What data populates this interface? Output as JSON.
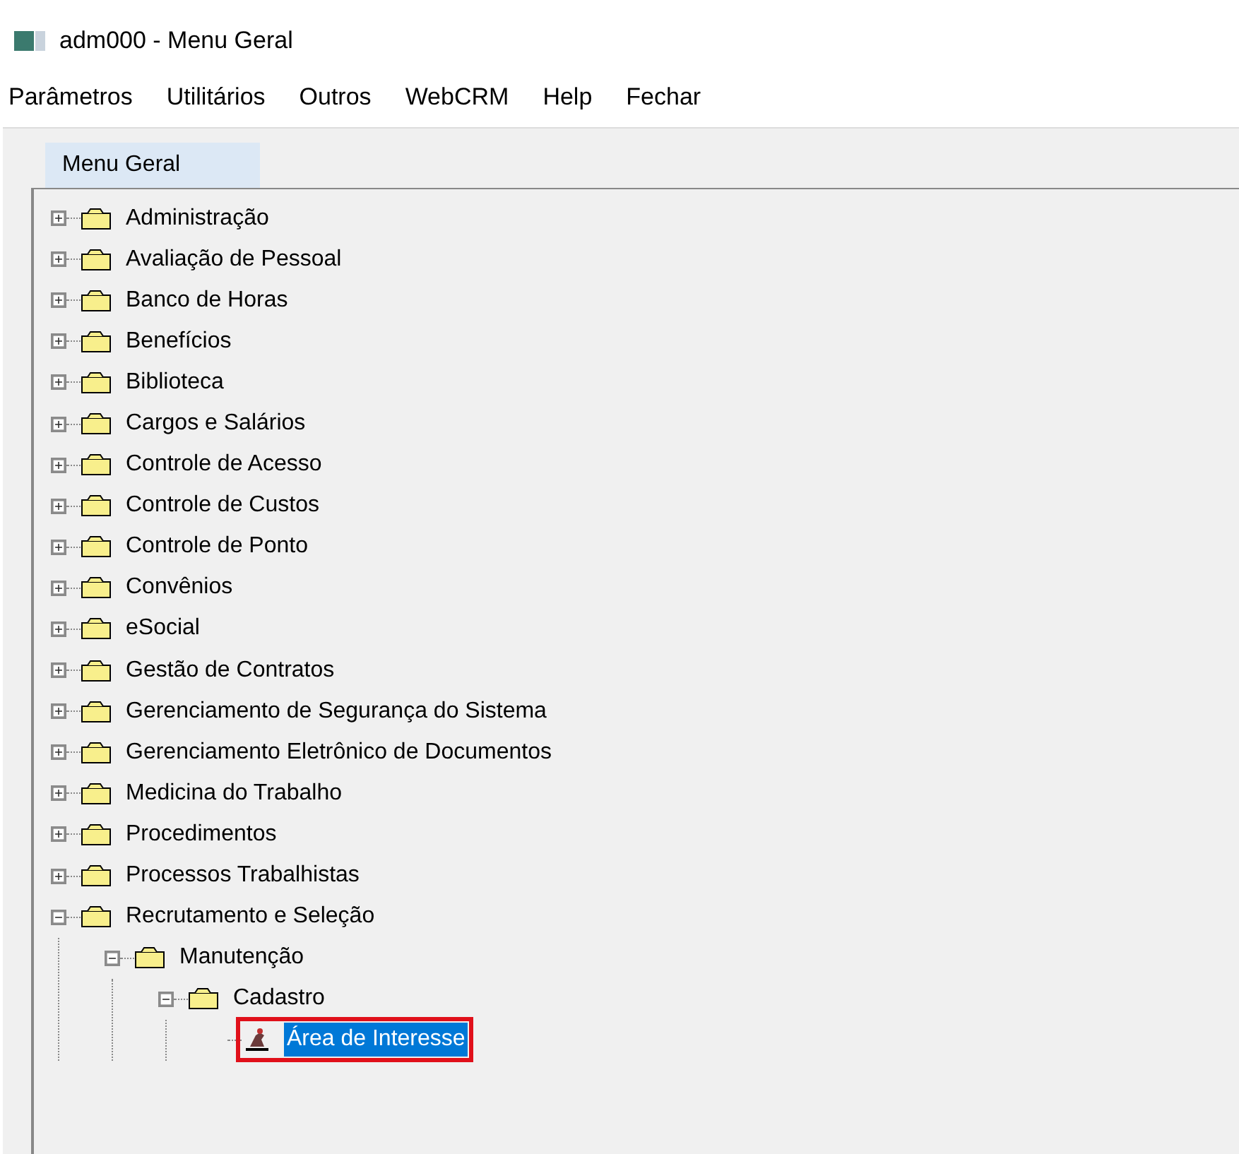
{
  "window": {
    "title": "adm000 - Menu Geral"
  },
  "menu": [
    "Parâmetros",
    "Utilitários",
    "Outros",
    "WebCRM",
    "Help",
    "Fechar"
  ],
  "tabs": [
    {
      "label": "Menu Geral",
      "selected": true
    }
  ],
  "tree": [
    {
      "label": "Administração",
      "kind": "folder",
      "expanded": false,
      "selected": false
    },
    {
      "label": "Avaliação de Pessoal",
      "kind": "folder",
      "expanded": false,
      "selected": false
    },
    {
      "label": "Banco de Horas",
      "kind": "folder",
      "expanded": false,
      "selected": false
    },
    {
      "label": "Benefícios",
      "kind": "folder",
      "expanded": false,
      "selected": false
    },
    {
      "label": "Biblioteca",
      "kind": "folder",
      "expanded": false,
      "selected": false
    },
    {
      "label": "Cargos e Salários",
      "kind": "folder",
      "expanded": false,
      "selected": false
    },
    {
      "label": "Controle de Acesso",
      "kind": "folder",
      "expanded": false,
      "selected": false
    },
    {
      "label": "Controle de Custos",
      "kind": "folder",
      "expanded": false,
      "selected": false
    },
    {
      "label": "Controle de Ponto",
      "kind": "folder",
      "expanded": false,
      "selected": false
    },
    {
      "label": "Convênios",
      "kind": "folder",
      "expanded": false,
      "selected": false
    },
    {
      "label": "eSocial",
      "kind": "folder",
      "expanded": false,
      "selected": false
    },
    {
      "label": "Gestão de Contratos",
      "kind": "folder",
      "expanded": false,
      "selected": false
    },
    {
      "label": "Gerenciamento de Segurança do Sistema",
      "kind": "folder",
      "expanded": false,
      "selected": false
    },
    {
      "label": "Gerenciamento Eletrônico de Documentos",
      "kind": "folder",
      "expanded": false,
      "selected": false
    },
    {
      "label": "Medicina do Trabalho",
      "kind": "folder",
      "expanded": false,
      "selected": false
    },
    {
      "label": "Procedimentos",
      "kind": "folder",
      "expanded": false,
      "selected": false
    },
    {
      "label": "Processos Trabalhistas",
      "kind": "folder",
      "expanded": false,
      "selected": false
    },
    {
      "label": "Recrutamento e Seleção",
      "kind": "folder",
      "expanded": true,
      "selected": false,
      "children": [
        {
          "label": "Manutenção",
          "kind": "folder",
          "expanded": true,
          "selected": false,
          "children": [
            {
              "label": "Cadastro",
              "kind": "folder",
              "expanded": true,
              "selected": false,
              "children": [
                {
                  "label": "Área de Interesse",
                  "kind": "program",
                  "selected": true,
                  "highlighted": true
                }
              ]
            }
          ]
        }
      ]
    }
  ]
}
